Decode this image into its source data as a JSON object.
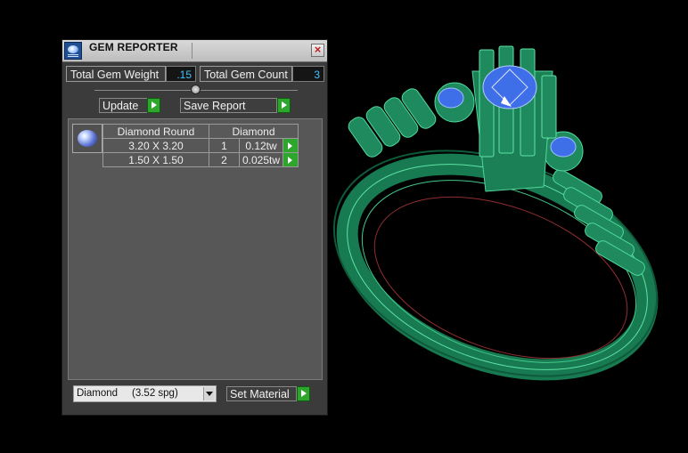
{
  "window": {
    "title": "GEM REPORTER"
  },
  "summary": {
    "total_weight_label": "Total Gem Weight",
    "total_weight_value": ".15",
    "total_count_label": "Total Gem Count",
    "total_count_value": "3"
  },
  "actions": {
    "update_label": "Update",
    "save_label": "Save Report"
  },
  "gem_table": {
    "columns": [
      "Diamond Round",
      "Diamond"
    ],
    "rows": [
      {
        "size": "3.20 X 3.20",
        "qty": "1",
        "weight": "0.12tw"
      },
      {
        "size": "1.50 X 1.50",
        "qty": "2",
        "weight": "0.025tw"
      }
    ]
  },
  "material": {
    "selected": "Diamond     (3.52 spg)",
    "set_label": "Set Material"
  },
  "colors": {
    "ring_green": "#1e8a5e",
    "gem_blue": "#3f6fe8",
    "accent_green": "#2ea62e"
  }
}
